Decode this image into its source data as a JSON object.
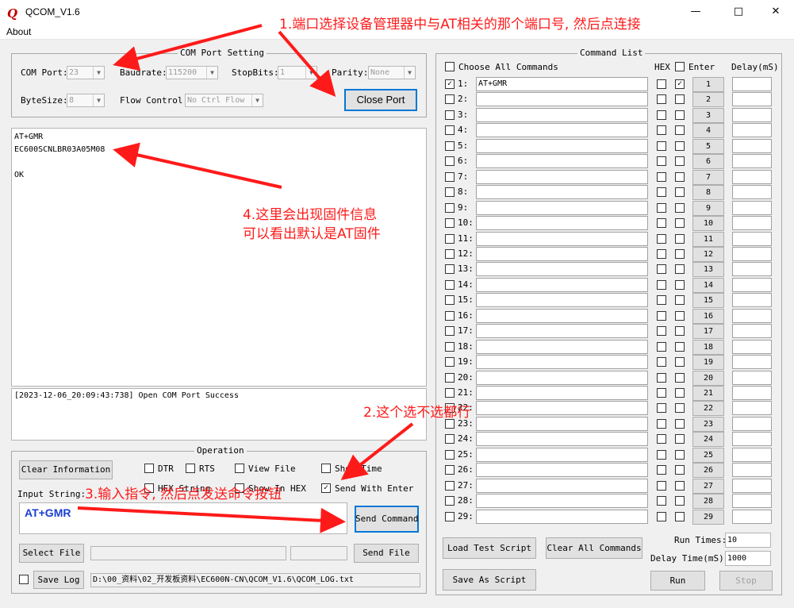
{
  "window": {
    "app_icon": "Q",
    "title": "QCOM_V1.6",
    "minimize": "—",
    "maximize": "□",
    "close": "✕"
  },
  "menu": {
    "about": "About"
  },
  "com_setting": {
    "title": "COM Port Setting",
    "com_port_label": "COM Port:",
    "com_port_value": "23",
    "baudrate_label": "Baudrate:",
    "baudrate_value": "115200",
    "stopbits_label": "StopBits:",
    "stopbits_value": "1",
    "parity_label": "Parity:",
    "parity_value": "None",
    "bytesize_label": "ByteSize:",
    "bytesize_value": "8",
    "flow_label": "Flow Control:",
    "flow_value": "No Ctrl Flow",
    "close_port": "Close Port"
  },
  "receive": {
    "lines": [
      "AT+GMR",
      "EC600SCNLBR03A05M08",
      "",
      "OK"
    ]
  },
  "log": {
    "line": "[2023-12-06_20:09:43:738] Open COM Port Success"
  },
  "operation": {
    "title": "Operation",
    "clear_info": "Clear Information",
    "dtr": "DTR",
    "rts": "RTS",
    "view_file": "View File",
    "show_time": "Show Time",
    "hex_string": "HEX String",
    "show_in_hex": "Show In HEX",
    "send_with_enter": "Send With Enter",
    "input_label": "Input String:",
    "input_value": "AT+GMR",
    "send_command": "Send Command",
    "select_file": "Select File",
    "send_file": "Send File",
    "save_log": "Save Log",
    "log_path": "D:\\00_资料\\02_开发板资料\\EC600N-CN\\QCOM_V1.6\\QCOM_LOG.txt"
  },
  "command_list": {
    "title": "Command List",
    "choose_all": "Choose All Commands",
    "hex_header": "HEX",
    "enter_header": "Enter",
    "delay_header": "Delay(mS)",
    "rows": [
      {
        "num": "1:",
        "cmd": "AT+GMR",
        "btn": "1",
        "checked": true
      },
      {
        "num": "2:",
        "cmd": "",
        "btn": "2",
        "checked": false
      },
      {
        "num": "3:",
        "cmd": "",
        "btn": "3",
        "checked": false
      },
      {
        "num": "4:",
        "cmd": "",
        "btn": "4",
        "checked": false
      },
      {
        "num": "5:",
        "cmd": "",
        "btn": "5",
        "checked": false
      },
      {
        "num": "6:",
        "cmd": "",
        "btn": "6",
        "checked": false
      },
      {
        "num": "7:",
        "cmd": "",
        "btn": "7",
        "checked": false
      },
      {
        "num": "8:",
        "cmd": "",
        "btn": "8",
        "checked": false
      },
      {
        "num": "9:",
        "cmd": "",
        "btn": "9",
        "checked": false
      },
      {
        "num": "10:",
        "cmd": "",
        "btn": "10",
        "checked": false
      },
      {
        "num": "11:",
        "cmd": "",
        "btn": "11",
        "checked": false
      },
      {
        "num": "12:",
        "cmd": "",
        "btn": "12",
        "checked": false
      },
      {
        "num": "13:",
        "cmd": "",
        "btn": "13",
        "checked": false
      },
      {
        "num": "14:",
        "cmd": "",
        "btn": "14",
        "checked": false
      },
      {
        "num": "15:",
        "cmd": "",
        "btn": "15",
        "checked": false
      },
      {
        "num": "16:",
        "cmd": "",
        "btn": "16",
        "checked": false
      },
      {
        "num": "17:",
        "cmd": "",
        "btn": "17",
        "checked": false
      },
      {
        "num": "18:",
        "cmd": "",
        "btn": "18",
        "checked": false
      },
      {
        "num": "19:",
        "cmd": "",
        "btn": "19",
        "checked": false
      },
      {
        "num": "20:",
        "cmd": "",
        "btn": "20",
        "checked": false
      },
      {
        "num": "21:",
        "cmd": "",
        "btn": "21",
        "checked": false
      },
      {
        "num": "22:",
        "cmd": "",
        "btn": "22",
        "checked": false
      },
      {
        "num": "23:",
        "cmd": "",
        "btn": "23",
        "checked": false
      },
      {
        "num": "24:",
        "cmd": "",
        "btn": "24",
        "checked": false
      },
      {
        "num": "25:",
        "cmd": "",
        "btn": "25",
        "checked": false
      },
      {
        "num": "26:",
        "cmd": "",
        "btn": "26",
        "checked": false
      },
      {
        "num": "27:",
        "cmd": "",
        "btn": "27",
        "checked": false
      },
      {
        "num": "28:",
        "cmd": "",
        "btn": "28",
        "checked": false
      },
      {
        "num": "29:",
        "cmd": "",
        "btn": "29",
        "checked": false
      }
    ],
    "load_script": "Load Test Script",
    "clear_all": "Clear All Commands",
    "save_script": "Save As Script",
    "run_times_label": "Run Times:",
    "run_times_value": "10",
    "delay_time_label": "Delay Time(mS):",
    "delay_time_value": "1000",
    "run": "Run",
    "stop": "Stop"
  },
  "annotations": {
    "a1": "1.端口选择设备管理器中与AT相关的那个端口号, 然后点连接",
    "a2": "2.这个选不选都行",
    "a3": "3.输入指令, 然后点发送命令按钮",
    "a4_line1": "4.这里会出现固件信息",
    "a4_line2": "可以看出默认是AT固件",
    "color": "#ff1a1a"
  }
}
